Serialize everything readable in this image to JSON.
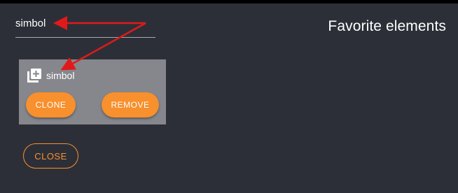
{
  "search": {
    "value": "simbol"
  },
  "panel": {
    "title": "Favorite elements"
  },
  "card": {
    "icon": "add-to-library-icon",
    "name": "simbol",
    "clone_label": "CLONE",
    "remove_label": "REMOVE"
  },
  "footer": {
    "close_label": "CLOSE"
  },
  "colors": {
    "background": "#2d2f38",
    "card": "#86878c",
    "accent": "#f7902d",
    "annotation_arrow": "#e01a1a"
  }
}
